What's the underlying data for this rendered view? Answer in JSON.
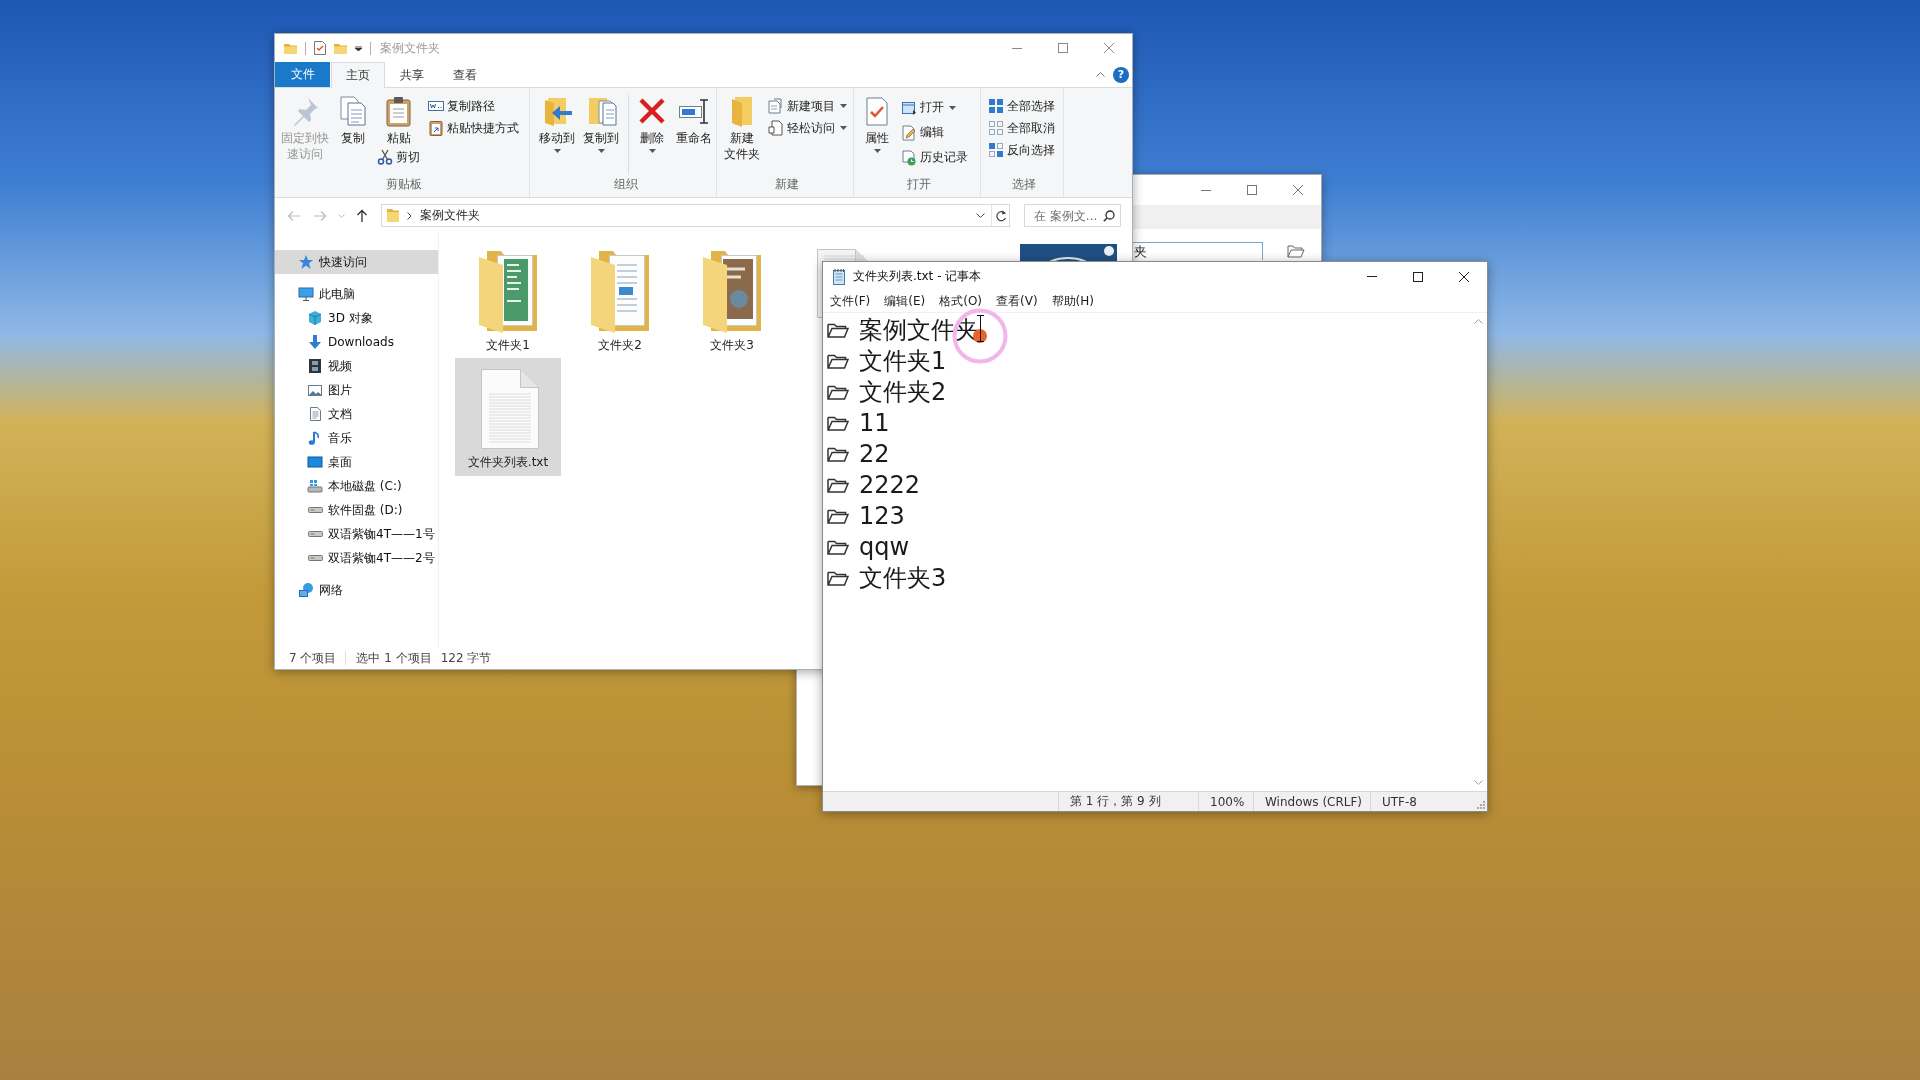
{
  "explorer": {
    "title": "案例文件夹",
    "ribbon": {
      "tabs": [
        {
          "label": "文件",
          "kind": "menu",
          "selected": false
        },
        {
          "label": "主页",
          "kind": "tab",
          "selected": true
        },
        {
          "label": "共享",
          "kind": "tab",
          "selected": false
        },
        {
          "label": "查看",
          "kind": "tab",
          "selected": false
        }
      ],
      "help": "?",
      "groups": [
        {
          "label": "剪贴板",
          "columns": [
            [
              {
                "kind": "large",
                "lines": [
                  "固定到快",
                  "速访问"
                ],
                "dropdown": false,
                "disabled": true
              }
            ],
            [
              {
                "kind": "large",
                "lines": [
                  "复制"
                ],
                "dropdown": false,
                "disabled": false
              }
            ],
            [
              {
                "kind": "large",
                "lines": [
                  "粘贴"
                ],
                "dropdown": false,
                "disabled": false
              },
              {
                "kind": "small",
                "label": "剪切",
                "dropdown": false,
                "disabled": false
              }
            ],
            [
              {
                "kind": "small",
                "label": "复制路径",
                "dropdown": false,
                "disabled": false
              },
              {
                "kind": "small",
                "label": "粘贴快捷方式",
                "dropdown": false,
                "disabled": false
              }
            ]
          ]
        },
        {
          "label": "组织",
          "columns": [
            [
              {
                "kind": "large",
                "lines": [
                  "移动到"
                ],
                "dropdown": true,
                "disabled": false
              }
            ],
            [
              {
                "kind": "large",
                "lines": [
                  "复制到"
                ],
                "dropdown": true,
                "disabled": false
              }
            ],
            [
              {
                "kind": "large",
                "lines": [
                  "删除"
                ],
                "dropdown": true,
                "disabled": false
              }
            ],
            [
              {
                "kind": "large",
                "lines": [
                  "重命名"
                ],
                "dropdown": false,
                "disabled": false
              }
            ]
          ]
        },
        {
          "label": "新建",
          "columns": [
            [
              {
                "kind": "large",
                "lines": [
                  "新建",
                  "文件夹"
                ],
                "dropdown": false,
                "disabled": false
              }
            ],
            [
              {
                "kind": "small",
                "label": "新建项目",
                "dropdown": true,
                "disabled": false
              },
              {
                "kind": "small",
                "label": "轻松访问",
                "dropdown": true,
                "disabled": false
              }
            ]
          ]
        },
        {
          "label": "打开",
          "columns": [
            [
              {
                "kind": "large",
                "lines": [
                  "属性"
                ],
                "dropdown": true,
                "disabled": false
              }
            ],
            [
              {
                "kind": "small",
                "label": "打开",
                "dropdown": true,
                "disabled": false
              },
              {
                "kind": "small",
                "label": "编辑",
                "dropdown": false,
                "disabled": false
              },
              {
                "kind": "small",
                "label": "历史记录",
                "dropdown": false,
                "disabled": false
              }
            ]
          ]
        },
        {
          "label": "选择",
          "columns": [
            [
              {
                "kind": "small",
                "label": "全部选择",
                "dropdown": false,
                "disabled": false
              },
              {
                "kind": "small",
                "label": "全部取消",
                "dropdown": false,
                "disabled": false
              },
              {
                "kind": "small",
                "label": "反向选择",
                "dropdown": false,
                "disabled": false
              }
            ]
          ]
        }
      ]
    },
    "address": {
      "path": [
        "案例文件夹"
      ]
    },
    "search": {
      "placeholder": "在 案例文..."
    },
    "nav_pane": {
      "items": [
        {
          "label": "快速访问",
          "selected": true
        },
        {
          "label": "此电脑",
          "selected": false,
          "children": [
            {
              "label": "3D 对象",
              "selected": false
            },
            {
              "label": "Downloads",
              "selected": false
            },
            {
              "label": "视频",
              "selected": false
            },
            {
              "label": "图片",
              "selected": false
            },
            {
              "label": "文档",
              "selected": false
            },
            {
              "label": "音乐",
              "selected": false
            },
            {
              "label": "桌面",
              "selected": false
            },
            {
              "label": "本地磁盘 (C:)",
              "selected": false
            },
            {
              "label": "软件固盘 (D:)",
              "selected": false
            },
            {
              "label": "双语紫铷4T——1号",
              "selected": false
            },
            {
              "label": "双语紫铷4T——2号",
              "selected": false
            }
          ]
        },
        {
          "label": "网络",
          "selected": false
        }
      ]
    },
    "files": [
      {
        "name": "文件夹1",
        "kind": "folder",
        "selected": false
      },
      {
        "name": "文件夹2",
        "kind": "folder",
        "selected": false
      },
      {
        "name": "文件夹3",
        "kind": "folder",
        "selected": false
      },
      {
        "kind": "document"
      },
      {
        "kind": "image"
      },
      {
        "name": "文件夹列表.txt",
        "kind": "text",
        "selected": true
      }
    ],
    "status_bar": {
      "item_count": "7 个项目",
      "selection": "选中 1 个项目",
      "size": "122 字节"
    }
  },
  "background_window": {
    "field_value": "夹"
  },
  "notepad": {
    "title": "文件夹列表.txt - 记事本",
    "menu": [
      "文件(F)",
      "编辑(E)",
      "格式(O)",
      "查看(V)",
      "帮助(H)"
    ],
    "lines": [
      "案例文件夹",
      "文件夹1",
      "文件夹2",
      "11",
      "22",
      "2222",
      "123",
      "qqw",
      "文件夹3"
    ],
    "status_bar": {
      "position": "第 1 行，第 9 列",
      "zoom": "100%",
      "line_ending": "Windows (CRLF)",
      "encoding": "UTF-8"
    }
  }
}
